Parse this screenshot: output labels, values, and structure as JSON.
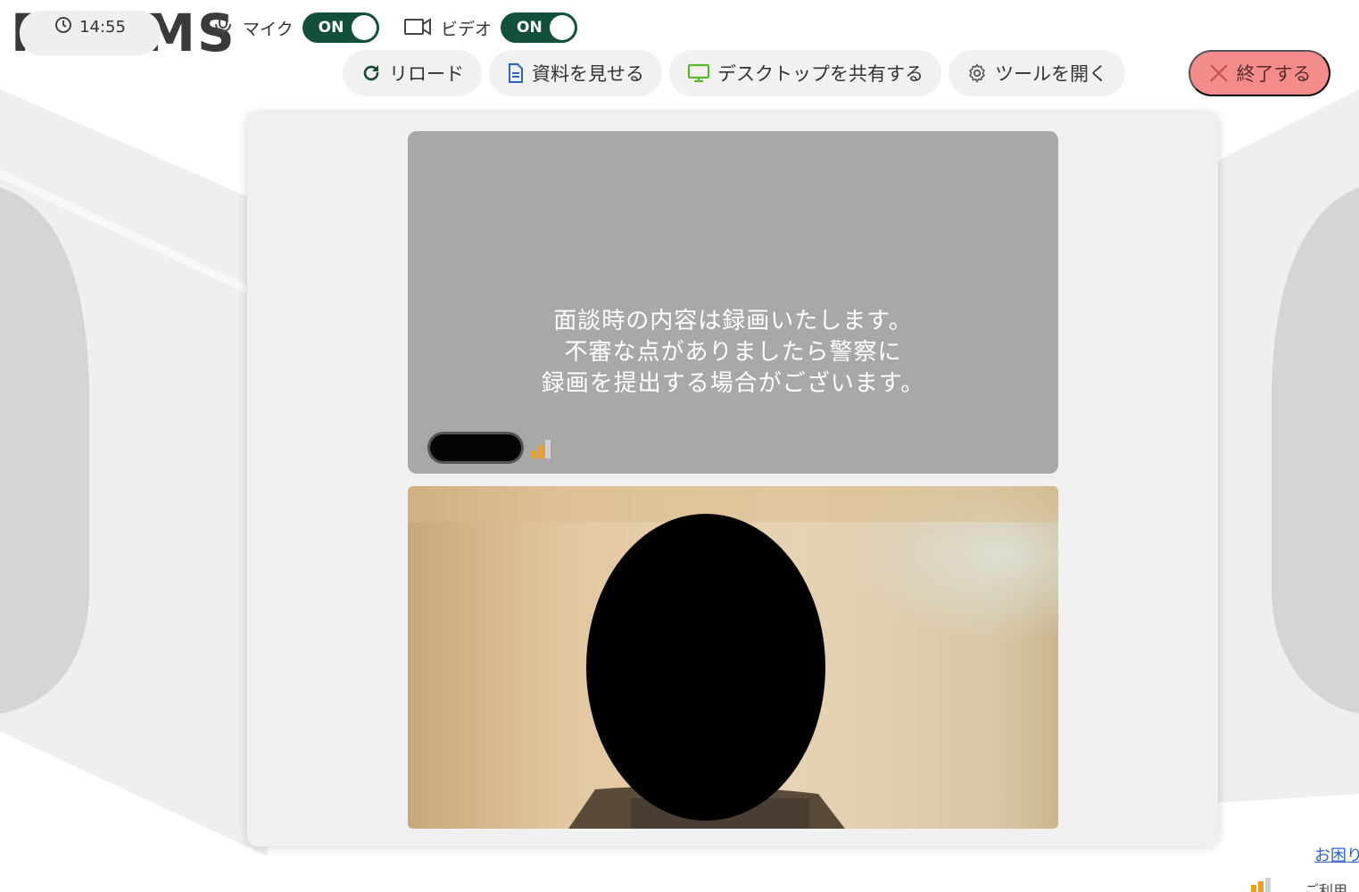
{
  "app": {
    "logo": {
      "r": "R",
      "o1": "O",
      "o2": "O",
      "rest": "MS"
    },
    "brand_colors": {
      "dark_green": "#1f6b2a",
      "lime": "#8bb82b",
      "text": "#3a3a3a"
    }
  },
  "toolbar": {
    "reload_label": "リロード",
    "show_docs_label": "資料を見せる",
    "share_desktop_label": "デスクトップを共有する",
    "open_tools_label": "ツールを開く",
    "end_label": "終了する",
    "end_color": "#f48c8c"
  },
  "remote_video": {
    "notice_line1": "面談時の内容は録画いたします。",
    "notice_line2": "不審な点がありましたら警察に",
    "notice_line3": "録画を提出する場合がございます。",
    "signal_bars_active": 2,
    "signal_bars_total": 3
  },
  "bottom": {
    "time": "14:55",
    "mic_label": "マイク",
    "mic_state": "ON",
    "video_label": "ビデオ",
    "video_state": "ON",
    "help_link": "お困り",
    "usage_label": "ご利用"
  }
}
